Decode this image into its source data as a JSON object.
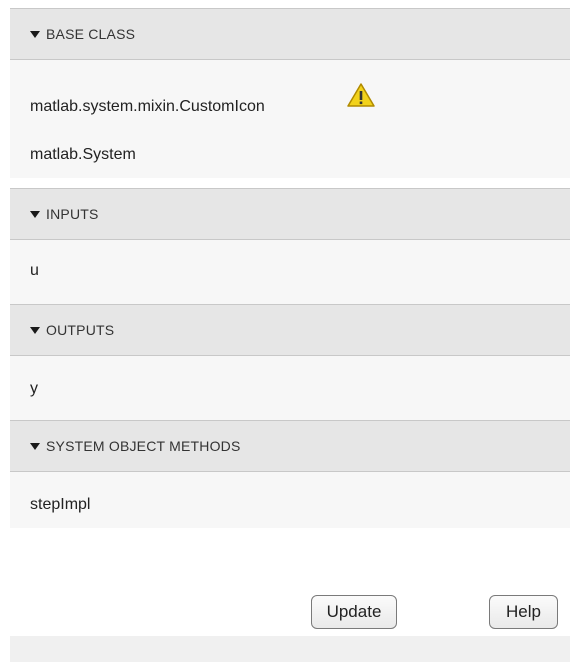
{
  "sections": {
    "base_class": {
      "title": "BASE CLASS",
      "items": [
        "matlab.system.mixin.CustomIcon",
        "matlab.System"
      ]
    },
    "inputs": {
      "title": "INPUTS",
      "items": [
        "u"
      ]
    },
    "outputs": {
      "title": "OUTPUTS",
      "items": [
        "y"
      ]
    },
    "methods": {
      "title": "SYSTEM OBJECT METHODS",
      "items": [
        "stepImpl"
      ]
    }
  },
  "buttons": {
    "update": "Update",
    "help": "Help"
  },
  "icons": {
    "expand": "triangle-down-icon",
    "warning": "warning-icon"
  },
  "colors": {
    "header_bg": "#e6e6e6",
    "body_bg": "#f7f7f7",
    "warning": "#f2d21b"
  }
}
